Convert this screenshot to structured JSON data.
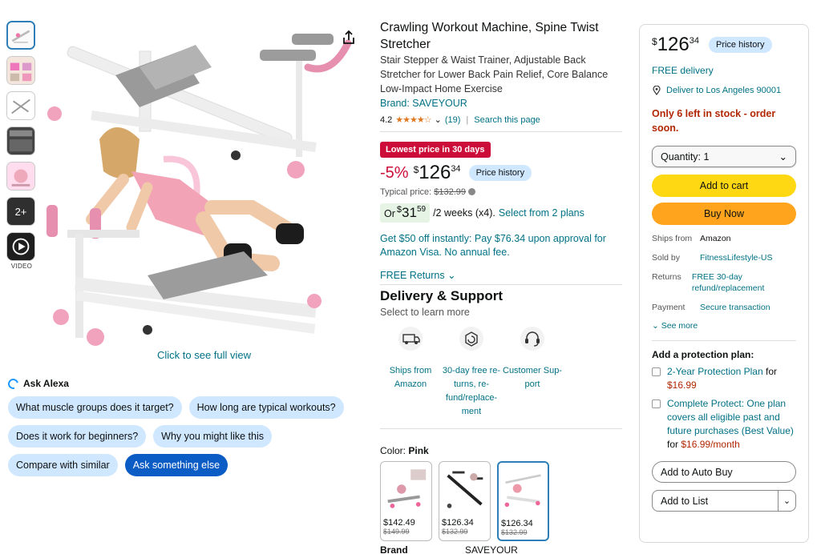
{
  "thumbnails": {
    "more_label": "2+",
    "video_label": "VIDEO"
  },
  "gallery": {
    "full_view_label": "Click to see full view"
  },
  "alexa": {
    "title": "Ask Alexa",
    "chips": [
      "What muscle groups does it target?",
      "How long are typical workouts?",
      "Does it work for beginners?",
      "Why you might like this",
      "Compare with similar",
      "Ask something else"
    ]
  },
  "product": {
    "title": "Crawling Workout Machine, Spine Twist Stretcher",
    "subtitle": "Stair Stepper & Waist Trainer, Adjustable Back Stretcher for Lower Back Pain Relief, Core Balance Low-Impact Home Exercise",
    "brand_link": "Brand: SAVEYOUR",
    "rating": "4.2",
    "stars": "★★★★☆",
    "review_count": "(19)",
    "search_page": "Search this page",
    "deal_badge": "Lowest price in 30 days",
    "discount": "-5%",
    "currency": "$",
    "price_whole": "126",
    "price_cents": "34",
    "price_history": "Price history",
    "typical_label": "Typical price:",
    "typical_price": "$132.99",
    "plan_or": "Or",
    "plan_whole": "31",
    "plan_cents": "59",
    "plan_suffix": "/2 weeks (x4).",
    "plan_link": "Select from 2 plans",
    "visa_offer": "Get $50 off instantly: Pay $76.34 upon approval for Amazon Visa. No annual fee.",
    "returns": "FREE Returns",
    "delivery_title": "Delivery & Support",
    "delivery_sub": "Select to learn more",
    "features": [
      {
        "icon": "truck-icon",
        "label": "Ships from Amazon"
      },
      {
        "icon": "return-box-icon",
        "label": "30-day free re-turns, re-fund/replace-ment"
      },
      {
        "icon": "headset-icon",
        "label": "Customer Sup-port"
      }
    ],
    "color_label": "Color:",
    "color_value": "Pink",
    "variants": [
      {
        "price": "$142.49",
        "old": "$149.99"
      },
      {
        "price": "$126.34",
        "old": "$132.99"
      },
      {
        "price": "$126.34",
        "old": "$132.99"
      }
    ],
    "brand_row_label": "Brand",
    "brand_row_value": "SAVEYOUR"
  },
  "buybox": {
    "currency": "$",
    "price_whole": "126",
    "price_cents": "34",
    "price_history": "Price history",
    "free_delivery": "FREE delivery",
    "deliver_to": "Deliver to Los Angeles 90001",
    "stock": "Only 6 left in stock - order soon.",
    "quantity": "Quantity: 1",
    "add_to_cart": "Add to cart",
    "buy_now": "Buy Now",
    "ships_from_label": "Ships from",
    "ships_from": "Amazon",
    "sold_by_label": "Sold by",
    "sold_by": "FitnessLifestyle-US",
    "returns_label": "Returns",
    "returns": "FREE 30-day refund/replacement",
    "payment_label": "Payment",
    "payment": "Secure transaction",
    "see_more": "See more",
    "protection_title": "Add a protection plan:",
    "plan1_name": "2-Year Protection Plan",
    "plan1_for": "for",
    "plan1_price": "$16.99",
    "plan2_name": "Complete Protect: One plan covers all eligible past and future purchases (Best Value)",
    "plan2_for": "for",
    "plan2_price": "$16.99/month",
    "auto_buy": "Add to Auto Buy",
    "add_to_list": "Add to List"
  },
  "colors": {
    "link": "#007185",
    "deal_red": "#cc0c39",
    "cart_yellow": "#ffd814",
    "buy_orange": "#ffa41c",
    "chip_blue": "#cfe7ff",
    "chip_primary": "#0b5cc5"
  }
}
